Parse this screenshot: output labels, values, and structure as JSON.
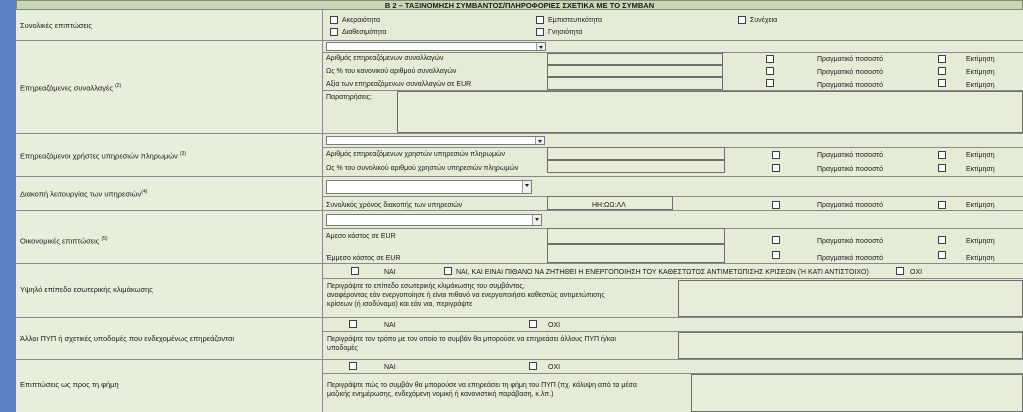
{
  "form": {
    "header_title": "Β 2 – ΤΑΞΙΝΟΜΗΣΗ ΣΥΜΒΑΝΤΟΣ/ΠΛΗΡΟΦΟΡΙΕΣ ΣΧΕΤΙΚΑ ΜΕ ΤΟ ΣΥΜΒΑΝ",
    "overall_impact": {
      "label": "Συνολικές επιπτώσεις",
      "options": [
        "Ακεραιότητα",
        "Εμπιστευτικότητα",
        "Συνέχεια",
        "Διαθεσιμότητα",
        "Γνησιότητα"
      ]
    },
    "affected_transactions": {
      "label": "Επηρεαζόμενες συναλλαγές",
      "sup": "(2)",
      "rows": [
        "Αριθμός επηρεαζόμενων συναλλαγών",
        "Ως % του κανονικού αριθμού συναλλαγών",
        "Αξία των επηρεαζόμενων συναλλαγών σε EUR"
      ],
      "notes_label": "Παρατηρήσεις:"
    },
    "actual_percentage": "Πραγματικό ποσοστό",
    "estimate": "Εκτίμηση",
    "affected_users": {
      "label": "Επηρεαζόμενοι χρήστες υπηρεσιών πληρωμών",
      "sup": "(3)",
      "rows": [
        "Αριθμός επηρεαζόμενων χρηστών υπηρεσιών πληρωμών",
        "Ως % του συνολικού αριθμού χρηστών υπηρεσιών πληρωμών"
      ]
    },
    "service_downtime": {
      "label": "Διακοπή λειτουργίας των υπηρεσιών",
      "sup": "(4)",
      "row": "Συνολικός χρόνος διακοπής των υπηρεσιών",
      "format": "ΗΗ:ΩΩ:ΛΛ"
    },
    "economic_impact": {
      "label": "Οικονομικές επιπτώσεις",
      "sup": "(5)",
      "rows": [
        "Άμεσο κόστος σε EUR",
        "Έμμεσο κόστος σε EUR"
      ]
    },
    "internal_escalation": {
      "label": "Υψηλό επίπεδο εσωτερικής κλιμάκωσης",
      "opt_yes": "ΝΑΙ",
      "opt_yes_crisis": "ΝΑΙ, ΚΑΙ ΕΙΝΑΙ ΠΙΘΑΝΟ ΝΑ ΖΗΤΗΘΕΙ Η ΕΝΕΡΓΟΠΟΙΗΣΗ ΤΟΥ ΚΑΘΕΣΤΩΤΟΣ ΑΝΤΙΜΕΤΩΠΙΣΗΣ ΚΡΙΣΕΩΝ (Ή ΚΑΤΙ ΑΝΤΙΣΤΟΙΧΟ)",
      "opt_no": "ΟΧΙ",
      "desc": [
        "Περιγράψτε το επίπεδο εσωτερικής κλιμάκωσης του συμβάντος,",
        "αναφέροντας εάν ενεργοποίησε ή είναι πιθανό να ενεργοποιήσει καθεστώς αντιμετώπισης",
        "κρίσεων (ή ισοδύναμο) και εάν ναι, περιγράψτε"
      ]
    },
    "other_psp": {
      "label": "Άλλοι ΠΥΠ ή σχετικές υποδομές που ενδεχομένως επηρεάζονται",
      "opt_yes": "ΝΑΙ",
      "opt_no": "ΟΧΙ",
      "desc": [
        "Περιγράψτε τον τρόπο με τον οποίο το συμβάν θα μπορούσε να επηρεάσει άλλους ΠΥΠ ή/και",
        "υποδομές"
      ]
    },
    "reputation": {
      "label": "Επιπτώσεις ως προς τη φήμη",
      "opt_yes": "ΝΑΙ",
      "opt_no": "ΟΧΙ",
      "desc": [
        "Περιγράψτε πώς το συμβάν θα μπορούσε να επηρεάσει τη φήμη του ΠΥΠ (πχ. κάλυψη από τα μέσα",
        "μαζικής ενημέρωσης, ενδεχόμενη νομική ή κανονιστική παράβαση, κ.λπ.)"
      ]
    }
  }
}
